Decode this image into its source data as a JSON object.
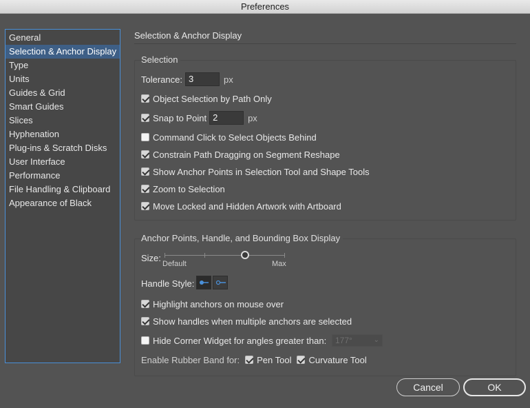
{
  "window": {
    "title": "Preferences"
  },
  "sidebar": {
    "items": [
      {
        "label": "General",
        "selected": false
      },
      {
        "label": "Selection & Anchor Display",
        "selected": true
      },
      {
        "label": "Type",
        "selected": false
      },
      {
        "label": "Units",
        "selected": false
      },
      {
        "label": "Guides & Grid",
        "selected": false
      },
      {
        "label": "Smart Guides",
        "selected": false
      },
      {
        "label": "Slices",
        "selected": false
      },
      {
        "label": "Hyphenation",
        "selected": false
      },
      {
        "label": "Plug-ins & Scratch Disks",
        "selected": false
      },
      {
        "label": "User Interface",
        "selected": false
      },
      {
        "label": "Performance",
        "selected": false
      },
      {
        "label": "File Handling & Clipboard",
        "selected": false
      },
      {
        "label": "Appearance of Black",
        "selected": false
      }
    ]
  },
  "section": {
    "title": "Selection & Anchor Display"
  },
  "selection": {
    "title": "Selection",
    "tolerance_label": "Tolerance:",
    "tolerance_value": "3",
    "tolerance_unit": "px",
    "object_selection_by_path_only": {
      "label": "Object Selection by Path Only",
      "checked": true
    },
    "snap_to_point": {
      "label": "Snap to Point",
      "checked": true,
      "value": "2",
      "unit": "px"
    },
    "command_click": {
      "label": "Command Click to Select Objects Behind",
      "checked": false
    },
    "constrain_path": {
      "label": "Constrain Path Dragging on Segment Reshape",
      "checked": true
    },
    "show_anchor_points": {
      "label": "Show Anchor Points in Selection Tool and Shape Tools",
      "checked": true
    },
    "zoom_to_selection": {
      "label": "Zoom to Selection",
      "checked": true
    },
    "move_locked": {
      "label": "Move Locked and Hidden Artwork with Artboard",
      "checked": true
    }
  },
  "anchor": {
    "title": "Anchor Points, Handle, and Bounding Box Display",
    "size_label": "Size:",
    "size_min_label": "Default",
    "size_max_label": "Max",
    "size_level": 0.67,
    "handle_style_label": "Handle Style:",
    "highlight_anchors": {
      "label": "Highlight anchors on mouse over",
      "checked": true
    },
    "show_handles": {
      "label": "Show handles when multiple anchors are selected",
      "checked": true
    },
    "hide_corner_widget": {
      "label": "Hide Corner Widget for angles greater than:",
      "checked": false,
      "value": "177°"
    },
    "rubber_band_label": "Enable Rubber Band for:",
    "pen_tool": {
      "label": "Pen Tool",
      "checked": true
    },
    "curvature_tool": {
      "label": "Curvature Tool",
      "checked": true
    }
  },
  "buttons": {
    "cancel": "Cancel",
    "ok": "OK"
  },
  "colors": {
    "background": "#535353",
    "selection": "#3e5f86",
    "accent_border": "#4a90d9"
  }
}
